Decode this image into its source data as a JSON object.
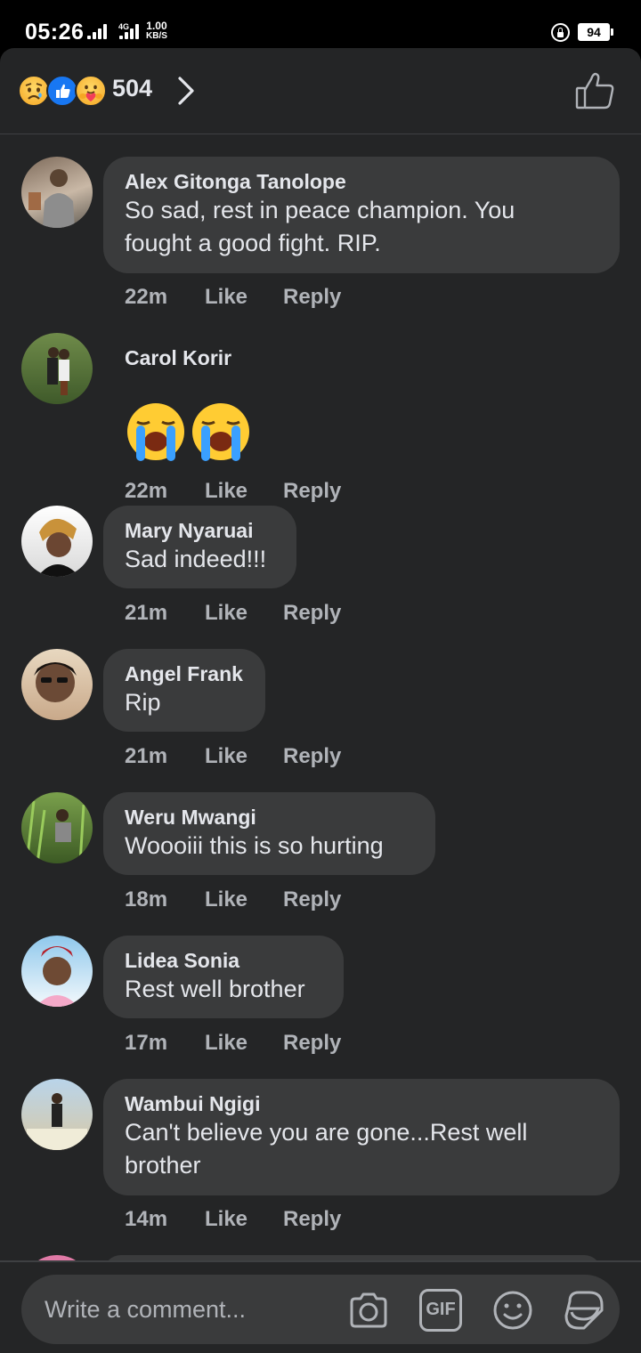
{
  "status_bar": {
    "time": "05:26",
    "network": "4G",
    "speed_value": "1.00",
    "speed_unit": "KB/S",
    "battery": "94"
  },
  "reactions": {
    "count": "504",
    "icons": [
      "sad-reaction-icon",
      "like-reaction-icon",
      "care-reaction-icon"
    ]
  },
  "comments": [
    {
      "author": "Alex Gitonga Tanolope",
      "text_lines": [
        "So sad, rest in peace champion. You",
        "fought a good fight. RIP."
      ],
      "time": "22m",
      "like": "Like",
      "reply": "Reply"
    },
    {
      "author": "Carol Korir",
      "text_lines": [],
      "emoji": "loudly-crying-face-icon x2",
      "time": "22m",
      "like": "Like",
      "reply": "Reply"
    },
    {
      "author": "Mary Nyaruai",
      "text_lines": [
        "Sad indeed!!!"
      ],
      "time": "21m",
      "like": "Like",
      "reply": "Reply"
    },
    {
      "author": "Angel Frank",
      "text_lines": [
        "Rip"
      ],
      "time": "21m",
      "like": "Like",
      "reply": "Reply"
    },
    {
      "author": "Weru Mwangi",
      "text_lines": [
        "Wooоiii this is so hurting"
      ],
      "time": "18m",
      "like": "Like",
      "reply": "Reply"
    },
    {
      "author": "Lidea Sonia",
      "text_lines": [
        "Rest well brother"
      ],
      "time": "17m",
      "like": "Like",
      "reply": "Reply"
    },
    {
      "author": "Wambui Ngigi",
      "text_lines": [
        "Can't believe you are gone...Rest well",
        "brother"
      ],
      "time": "14m",
      "like": "Like",
      "reply": "Reply"
    }
  ],
  "composer": {
    "placeholder": "Write a comment...",
    "tools": [
      "camera-icon",
      "gif-icon",
      "emoji-icon",
      "sticker-icon"
    ],
    "gif_label": "GIF"
  },
  "colors": {
    "panel_bg": "#242526",
    "bubble_bg": "#3a3b3c",
    "text_primary": "#e4e6eb",
    "text_secondary": "#b0b3b8",
    "like_blue": "#1877f2"
  }
}
